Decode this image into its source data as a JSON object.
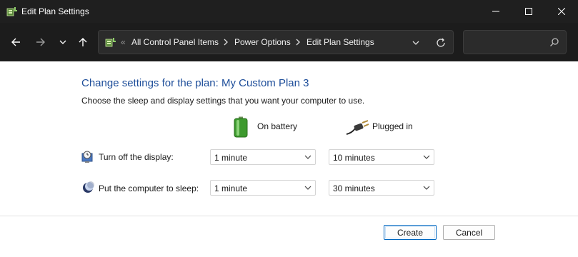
{
  "window": {
    "title": "Edit Plan Settings"
  },
  "address": {
    "overflow_glyph": "«",
    "crumbs": [
      "All Control Panel Items",
      "Power Options",
      "Edit Plan Settings"
    ]
  },
  "search": {
    "placeholder": "",
    "value": ""
  },
  "main": {
    "heading": "Change settings for the plan: My Custom Plan 3",
    "subheading": "Choose the sleep and display settings that you want your computer to use.",
    "columns": {
      "battery": "On battery",
      "plugged": "Plugged in"
    },
    "rows": [
      {
        "label": "Turn off the display:",
        "battery_value": "1 minute",
        "plugged_value": "10 minutes"
      },
      {
        "label": "Put the computer to sleep:",
        "battery_value": "1 minute",
        "plugged_value": "30 minutes"
      }
    ]
  },
  "footer": {
    "create_label": "Create",
    "cancel_label": "Cancel"
  },
  "colors": {
    "titlebar_bg": "#1f1f1f",
    "navbar_bg": "#1c1c1c",
    "heading": "#1e4e9a",
    "accent": "#0067c0"
  }
}
